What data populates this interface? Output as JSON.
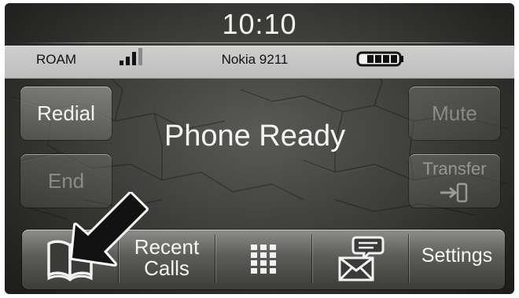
{
  "header": {
    "time": "10:10",
    "roaming": "ROAM",
    "device_name": "Nokia 9211"
  },
  "left_buttons": {
    "redial": "Redial",
    "end": "End"
  },
  "right_buttons": {
    "mute": "Mute",
    "transfer": "Transfer"
  },
  "status_message": "Phone Ready",
  "bottom_bar": {
    "recent_calls_line1": "Recent",
    "recent_calls_line2": "Calls",
    "settings": "Settings"
  },
  "icons": [
    "signal-strength-icon",
    "battery-icon",
    "phonebook-icon",
    "keypad-icon",
    "messaging-icon",
    "transfer-icon",
    "pointer-arrow-icon"
  ]
}
